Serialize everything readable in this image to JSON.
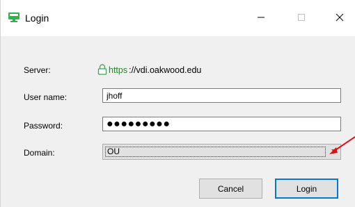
{
  "window": {
    "title": "Login"
  },
  "titlebar": {
    "app_icon": "monitor-icon",
    "minimize_icon": "minimize-icon",
    "maximize_icon": "maximize-icon",
    "close_icon": "close-icon"
  },
  "form": {
    "server_label": "Server:",
    "server_scheme": "https",
    "server_rest": "://vdi.oakwood.edu",
    "server_icon": "lock-icon",
    "username_label": "User name:",
    "username_value": "jhoff",
    "password_label": "Password:",
    "password_value": "●●●●●●●●●",
    "domain_label": "Domain:",
    "domain_value": "OU"
  },
  "buttons": {
    "cancel": "Cancel",
    "login": "Login"
  },
  "annotation": {
    "arrow_color": "#e01010"
  },
  "colors": {
    "https_green": "#1e8a1e",
    "focus_blue": "#0078d7",
    "icon_green": "#2fb34a"
  }
}
